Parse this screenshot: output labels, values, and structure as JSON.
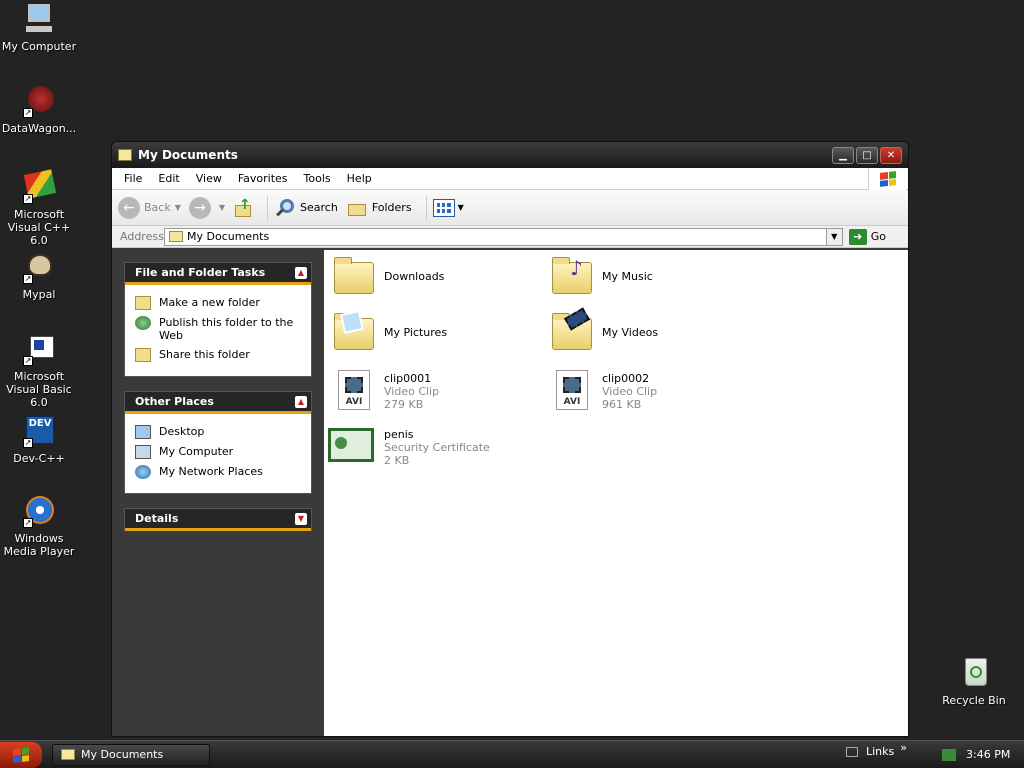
{
  "desktop": {
    "icons": [
      {
        "label": "My Computer"
      },
      {
        "label": "DataWagon..."
      },
      {
        "label": "Microsoft Visual C++ 6.0"
      },
      {
        "label": "Mypal"
      },
      {
        "label": "Microsoft Visual Basic 6.0"
      },
      {
        "label": "Dev-C++"
      },
      {
        "label": "Windows Media Player"
      },
      {
        "label": "Recycle Bin"
      }
    ]
  },
  "window": {
    "title": "My Documents",
    "menu": [
      "File",
      "Edit",
      "View",
      "Favorites",
      "Tools",
      "Help"
    ],
    "toolbar": {
      "back": "Back",
      "search": "Search",
      "folders": "Folders"
    },
    "address": {
      "label": "Address",
      "value": "My Documents",
      "go": "Go"
    }
  },
  "tasks": {
    "file_folder": {
      "title": "File and Folder Tasks",
      "items": [
        "Make a new folder",
        "Publish this folder to the Web",
        "Share this folder"
      ]
    },
    "other_places": {
      "title": "Other Places",
      "items": [
        "Desktop",
        "My Computer",
        "My Network Places"
      ]
    },
    "details": {
      "title": "Details"
    }
  },
  "files": [
    {
      "name": "Downloads"
    },
    {
      "name": "My Music"
    },
    {
      "name": "My Pictures"
    },
    {
      "name": "My Videos"
    },
    {
      "name": "clip0001",
      "type": "Video Clip",
      "size": "279 KB"
    },
    {
      "name": "clip0002",
      "type": "Video Clip",
      "size": "961 KB"
    },
    {
      "name": "penis",
      "type": "Security Certificate",
      "size": "2 KB"
    }
  ],
  "taskbar": {
    "task_label": "My Documents",
    "links": "Links",
    "links_chevron": "»",
    "clock": "3:46 PM"
  },
  "colors": {
    "accent": "#e8a014",
    "desktop": "#232323"
  }
}
